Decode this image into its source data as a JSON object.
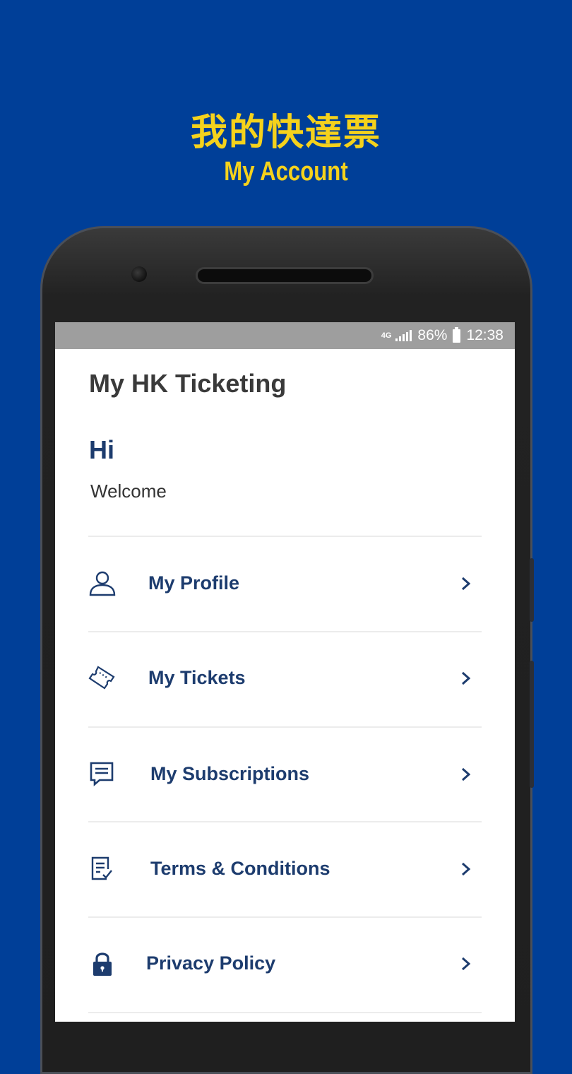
{
  "promo": {
    "title_zh": "我的快達票",
    "subtitle_en": "My Account"
  },
  "status_bar": {
    "network": "4G",
    "battery": "86%",
    "time": "12:38"
  },
  "app": {
    "title": "My HK Ticketing",
    "greeting": "Hi",
    "welcome": "Welcome"
  },
  "menu": {
    "items": [
      {
        "label": "My Profile",
        "icon": "user-icon"
      },
      {
        "label": "My Tickets",
        "icon": "ticket-icon"
      },
      {
        "label": "My Subscriptions",
        "icon": "message-icon"
      },
      {
        "label": "Terms & Conditions",
        "icon": "document-check-icon"
      },
      {
        "label": "Privacy Policy",
        "icon": "lock-icon"
      }
    ]
  },
  "colors": {
    "background": "#003f98",
    "promo_text": "#f5d21c",
    "menu_text": "#1d3c6e",
    "status_bar": "#9e9e9e"
  }
}
